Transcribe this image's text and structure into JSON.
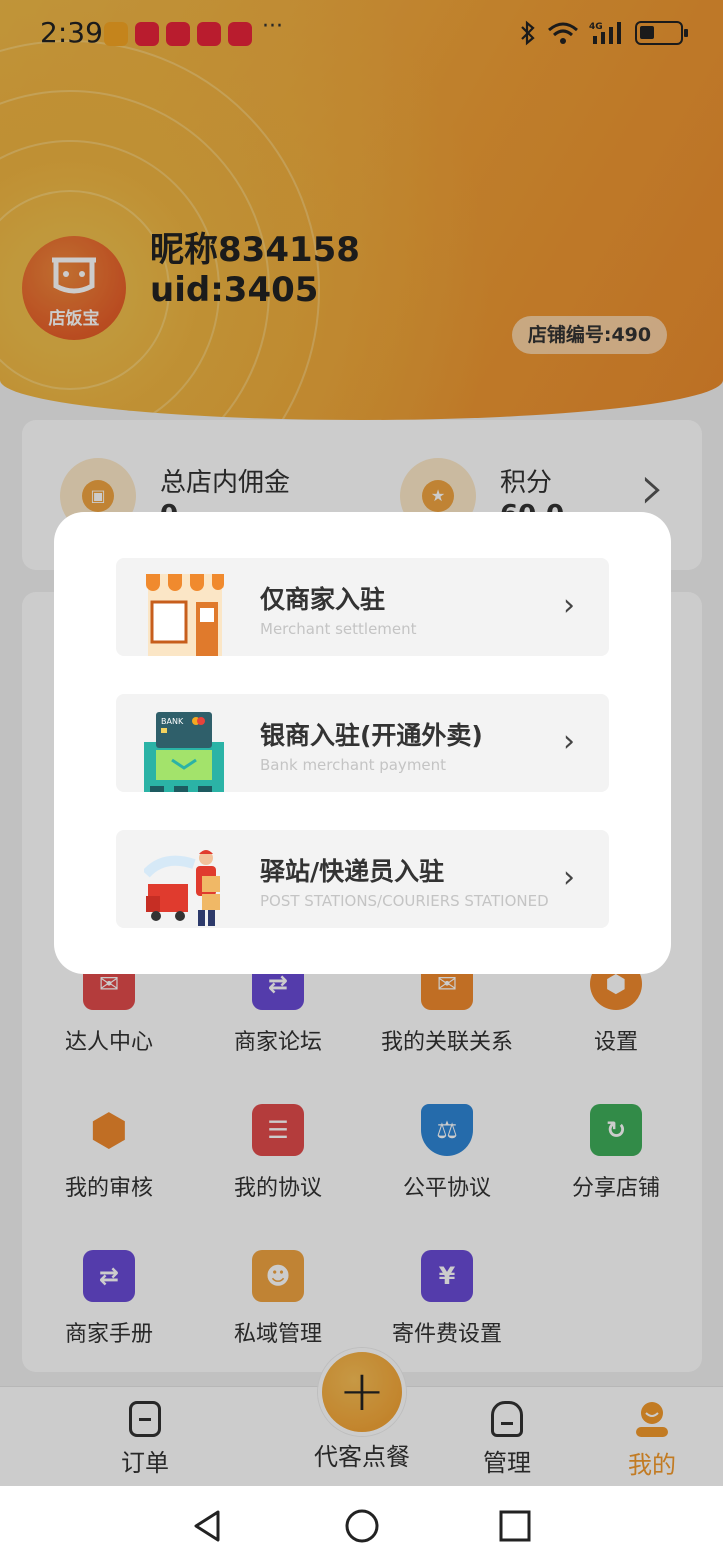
{
  "status_bar": {
    "time": "2:39",
    "more": "···",
    "network": "4G"
  },
  "profile": {
    "avatar_text": "店饭宝",
    "nickname": "昵称834158",
    "uid": "uid:3405",
    "shop_number": "店铺编号:490"
  },
  "stats": {
    "commission_label": "总店内佣金",
    "commission_value": "0",
    "points_label": "积分",
    "points_value": "60.0"
  },
  "grid": {
    "items": [
      {
        "label": "达人中心",
        "icon": "gift-icon",
        "color": "#e24c4c"
      },
      {
        "label": "商家论坛",
        "icon": "swap-icon",
        "color": "#6a4bd6"
      },
      {
        "label": "我的关联关系",
        "icon": "mail-icon",
        "color": "#f08a2e"
      },
      {
        "label": "设置",
        "icon": "hexagon-icon",
        "color": "#f08a2e"
      },
      {
        "label": "我的审核",
        "icon": "hexagon-icon",
        "color": "#f08a2e"
      },
      {
        "label": "我的协议",
        "icon": "document-icon",
        "color": "#e24c4c"
      },
      {
        "label": "公平协议",
        "icon": "scale-shield-icon",
        "color": "#2f86d6"
      },
      {
        "label": "分享店铺",
        "icon": "share-icon",
        "color": "#3fae5a"
      },
      {
        "label": "商家手册",
        "icon": "swap-icon",
        "color": "#6a4bd6"
      },
      {
        "label": "私域管理",
        "icon": "user-star-icon",
        "color": "#f1a441"
      },
      {
        "label": "寄件费设置",
        "icon": "box-price-icon",
        "color": "#6a4bd6"
      }
    ]
  },
  "tabbar": {
    "orders": "订单",
    "order_for_customer": "代客点餐",
    "fab_symbol": "+",
    "manage": "管理",
    "mine": "我的"
  },
  "modal": {
    "options": [
      {
        "title": "仅商家入驻",
        "subtitle": "Merchant settlement",
        "icon": "storefront-icon",
        "chevron": "›"
      },
      {
        "title": "银商入驻(开通外卖)",
        "subtitle": "Bank merchant payment",
        "icon": "bank-card-icon",
        "chevron": "›"
      },
      {
        "title": "驿站/快递员入驻",
        "subtitle": "POST STATIONS/COURIERS STATIONED",
        "icon": "courier-truck-icon",
        "chevron": "›"
      }
    ]
  },
  "colors": {
    "accent": "#f39a2c",
    "header_start": "#f2bf4e",
    "header_end": "#ec8c2e"
  }
}
